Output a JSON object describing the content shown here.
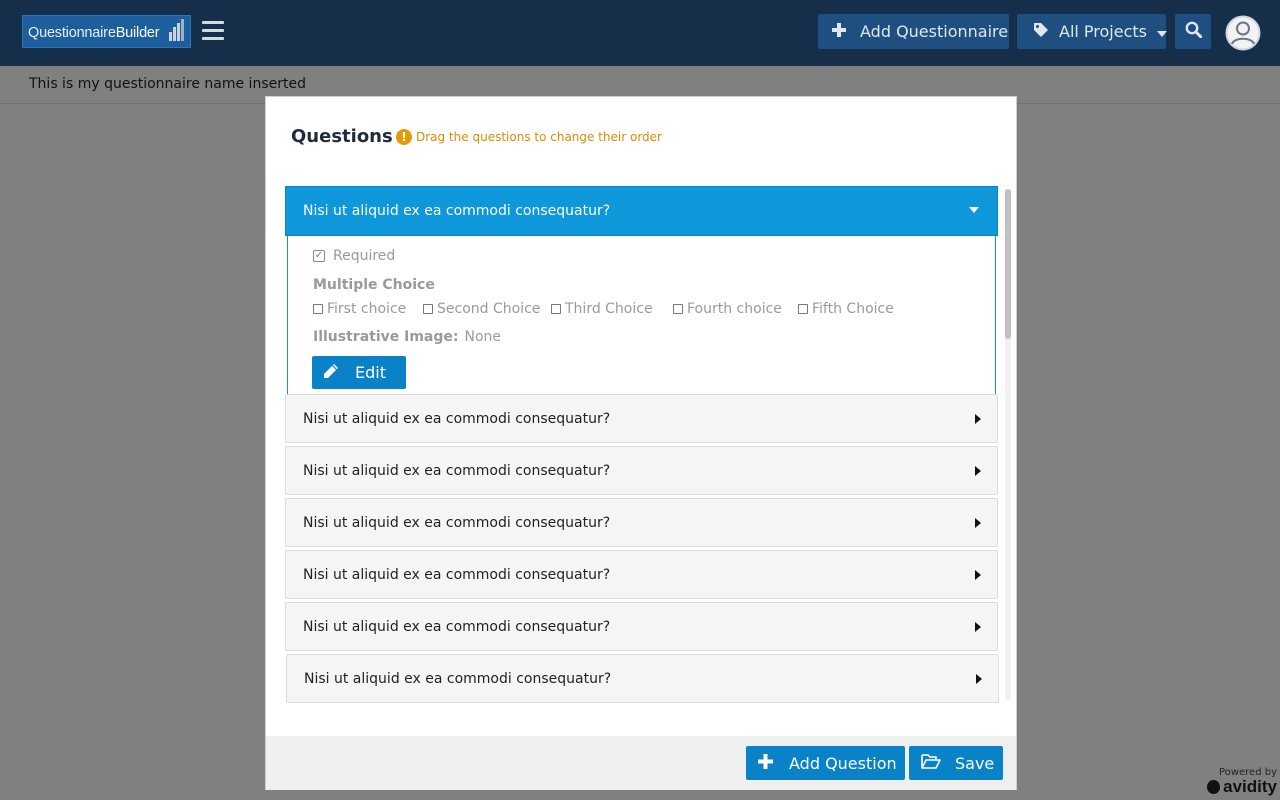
{
  "header": {
    "logo": {
      "part1": "Questionnaire",
      "part2": "Builder"
    },
    "add_questionnaire_label": "Add Questionnaire",
    "projects_label": "All Projects",
    "accent_color": "#152f4a"
  },
  "subheader": {
    "questionnaire_name": "This is my questionnaire name inserted"
  },
  "modal": {
    "title": "Questions",
    "hint": "Drag the questions to change their order",
    "open_question": {
      "title": "Nisi ut aliquid ex ea commodi consequatur?",
      "required_label": "Required",
      "type_label": "Multiple Choice",
      "choices": [
        "First choice",
        "Second Choice",
        "Third Choice",
        "Fourth choice",
        "Fifth Choice"
      ],
      "image_label": "Illustrative Image:",
      "image_value": "None",
      "edit_label": "Edit"
    },
    "questions": [
      "Nisi ut aliquid ex ea commodi consequatur?",
      "Nisi ut aliquid ex ea commodi consequatur?",
      "Nisi ut aliquid ex ea commodi consequatur?",
      "Nisi ut aliquid ex ea commodi consequatur?",
      "Nisi ut aliquid ex ea commodi consequatur?",
      "Nisi ut aliquid ex ea commodi consequatur?"
    ],
    "add_question_label": "Add Question",
    "save_label": "Save"
  },
  "footer": {
    "powered_by": "Powered by",
    "brand": "avidity"
  },
  "icons": {
    "menu": "hamburger-icon",
    "plus": "plus-icon",
    "tag": "tag-icon",
    "search": "search-icon",
    "user": "user-circle-icon",
    "warning": "exclamation-circle-icon",
    "pencil": "pencil-icon",
    "folder": "folder-open-icon"
  }
}
